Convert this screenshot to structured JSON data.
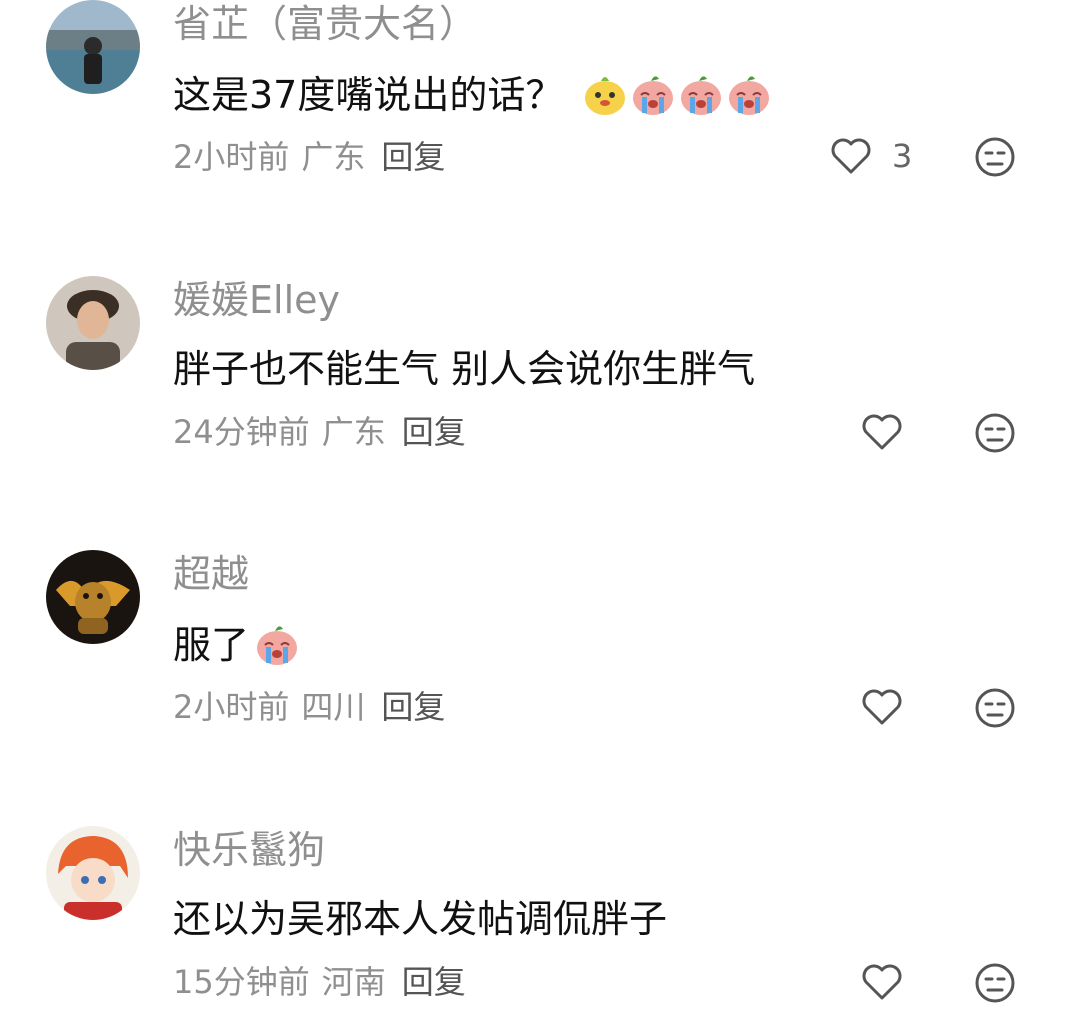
{
  "comments": [
    {
      "username": "省芷（富贵大名）",
      "text": "这是37度嘴说出的话？",
      "emojis": [
        "yellow-puppy-emoji",
        "crying-peach-emoji",
        "crying-peach-emoji",
        "crying-peach-emoji"
      ],
      "time": "2小时前",
      "location": "广东",
      "reply_label": "回复",
      "like_count": "3",
      "like_icon": "heart-outline-icon",
      "dislike_icon": "meh-face-icon"
    },
    {
      "username": "媛媛Elley",
      "text": "胖子也不能生气 别人会说你生胖气",
      "emojis": [],
      "time": "24分钟前",
      "location": "广东",
      "reply_label": "回复",
      "like_count": "",
      "like_icon": "heart-outline-icon",
      "dislike_icon": "meh-face-icon"
    },
    {
      "username": "超越",
      "text": "服了",
      "emojis": [
        "crying-peach-emoji"
      ],
      "time": "2小时前",
      "location": "四川",
      "reply_label": "回复",
      "like_count": "",
      "like_icon": "heart-outline-icon",
      "dislike_icon": "meh-face-icon"
    },
    {
      "username": "快乐鬣狗",
      "text": "还以为吴邪本人发帖调侃胖子",
      "emojis": [],
      "time": "15分钟前",
      "location": "河南",
      "reply_label": "回复",
      "like_count": "",
      "like_icon": "heart-outline-icon",
      "dislike_icon": "meh-face-icon"
    }
  ],
  "colors": {
    "secondary_text": "#8f8f8f",
    "primary_text": "#111111",
    "icon_stroke": "#555555"
  }
}
